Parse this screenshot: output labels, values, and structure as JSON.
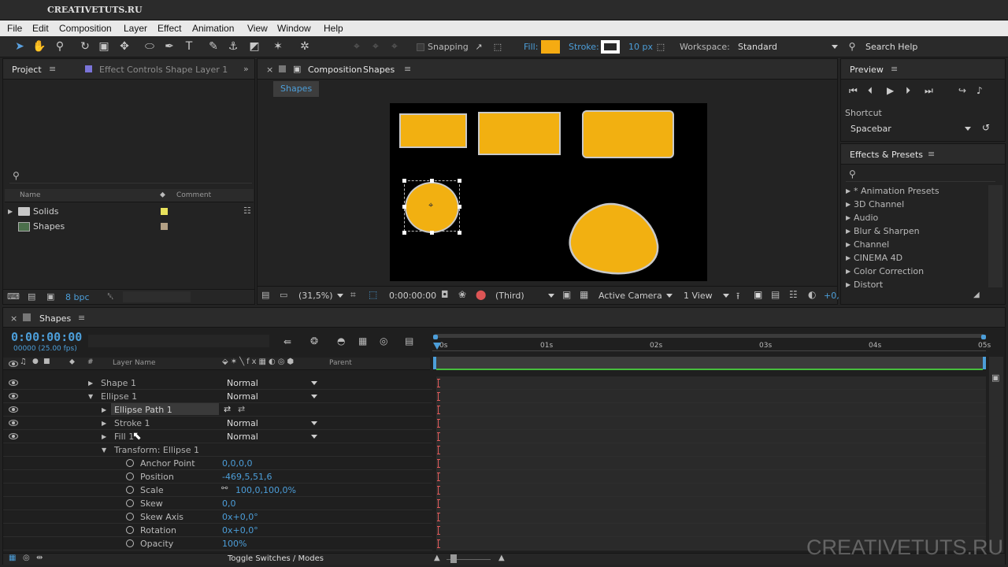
{
  "window": {
    "title": "CREATIVETUTS.RU"
  },
  "menu": [
    "File",
    "Edit",
    "Composition",
    "Layer",
    "Effect",
    "Animation",
    "View",
    "Window",
    "Help"
  ],
  "toolbar": {
    "snapping": "Snapping",
    "fill_label": "Fill:",
    "stroke_label": "Stroke:",
    "stroke_width": "10 px",
    "workspace_label": "Workspace:",
    "workspace_value": "Standard",
    "search_help": "Search Help",
    "fill_color": "#f5ab12",
    "accent": "#4c9ed9"
  },
  "project": {
    "tab": "Project",
    "effect_tab": "Effect Controls Shape Layer 1",
    "col_name": "Name",
    "col_comment": "Comment",
    "items": [
      {
        "name": "Solids",
        "label_color": "#e8e25c"
      },
      {
        "name": "Shapes",
        "label_color": "#b4a185"
      }
    ],
    "bpc": "8 bpc"
  },
  "composition": {
    "tab_prefix": "Composition",
    "tab_name": "Shapes",
    "flow_tab": "Shapes",
    "zoom": "(31,5%)",
    "timecode": "0:00:00:00",
    "resolution": "(Third)",
    "camera": "Active Camera",
    "views": "1 View",
    "exposure": "+0,"
  },
  "preview": {
    "title": "Preview",
    "shortcut_label": "Shortcut",
    "shortcut_value": "Spacebar"
  },
  "effects": {
    "title": "Effects & Presets",
    "items": [
      "* Animation Presets",
      "3D Channel",
      "Audio",
      "Blur & Sharpen",
      "Channel",
      "CINEMA 4D",
      "Color Correction",
      "Distort"
    ]
  },
  "timeline": {
    "tab": "Shapes",
    "timecode": "0:00:00:00",
    "fps": "00000 (25.00 fps)",
    "col_layer_name": "Layer Name",
    "col_parent": "Parent",
    "ruler": [
      "0s",
      "01s",
      "02s",
      "03s",
      "04s",
      "05s"
    ],
    "rows": [
      {
        "name": "Shape 1",
        "mode": "Normal",
        "indent": 1
      },
      {
        "name": "Ellipse 1",
        "mode": "Normal",
        "indent": 1,
        "open": true
      },
      {
        "name": "Ellipse Path 1",
        "indent": 2
      },
      {
        "name": "Stroke 1",
        "mode": "Normal",
        "indent": 2
      },
      {
        "name": "Fill 1",
        "mode": "Normal",
        "indent": 2
      },
      {
        "name": "Transform: Ellipse 1",
        "indent": 2,
        "open": true
      }
    ],
    "props": [
      {
        "name": "Anchor Point",
        "value": "0,0,0,0"
      },
      {
        "name": "Position",
        "value": "-469,5,51,6"
      },
      {
        "name": "Scale",
        "value": "100,0,100,0%"
      },
      {
        "name": "Skew",
        "value": "0,0"
      },
      {
        "name": "Skew Axis",
        "value": "0x+0,0°"
      },
      {
        "name": "Rotation",
        "value": "0x+0,0°"
      },
      {
        "name": "Opacity",
        "value": "100%"
      }
    ],
    "toggle": "Toggle Switches / Modes"
  },
  "watermark": "CREATIVETUTS.RU"
}
